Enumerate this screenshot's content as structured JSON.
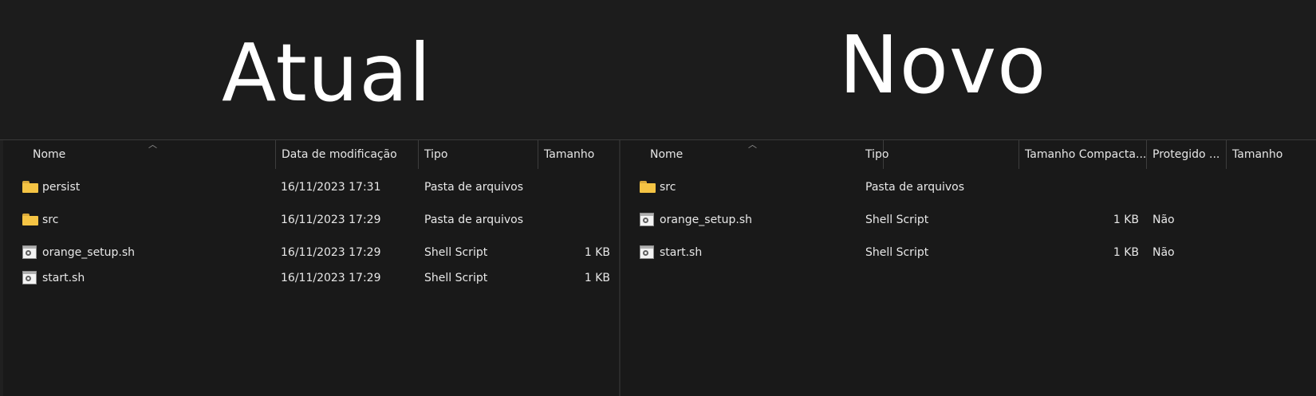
{
  "headings": {
    "left": "Atual",
    "right": "Novo"
  },
  "left_pane": {
    "columns": [
      "Nome",
      "Data de modificação",
      "Tipo",
      "Tamanho"
    ],
    "rows": [
      {
        "icon": "folder-icon",
        "name": "persist",
        "modified": "16/11/2023 17:31",
        "type": "Pasta de arquivos",
        "size": ""
      },
      {
        "icon": "folder-icon",
        "name": "src",
        "modified": "16/11/2023 17:29",
        "type": "Pasta de arquivos",
        "size": ""
      },
      {
        "icon": "script-icon",
        "name": "orange_setup.sh",
        "modified": "16/11/2023 17:29",
        "type": "Shell Script",
        "size": "1 KB"
      },
      {
        "icon": "script-icon",
        "name": "start.sh",
        "modified": "16/11/2023 17:29",
        "type": "Shell Script",
        "size": "1 KB"
      }
    ]
  },
  "right_pane": {
    "columns": [
      "Nome",
      "Tipo",
      "Tamanho Compacta...",
      "Protegido ...",
      "Tamanho"
    ],
    "rows": [
      {
        "icon": "folder-icon",
        "name": "src",
        "type": "Pasta de arquivos",
        "compressed": "",
        "protected": "",
        "size": ""
      },
      {
        "icon": "script-icon",
        "name": "orange_setup.sh",
        "type": "Shell Script",
        "compressed": "1 KB",
        "protected": "Não",
        "size": ""
      },
      {
        "icon": "script-icon",
        "name": "start.sh",
        "type": "Shell Script",
        "compressed": "1 KB",
        "protected": "Não",
        "size": ""
      }
    ]
  },
  "colors": {
    "background": "#1c1c1c",
    "folder": "#f5c444",
    "text": "#e8e8e8"
  }
}
